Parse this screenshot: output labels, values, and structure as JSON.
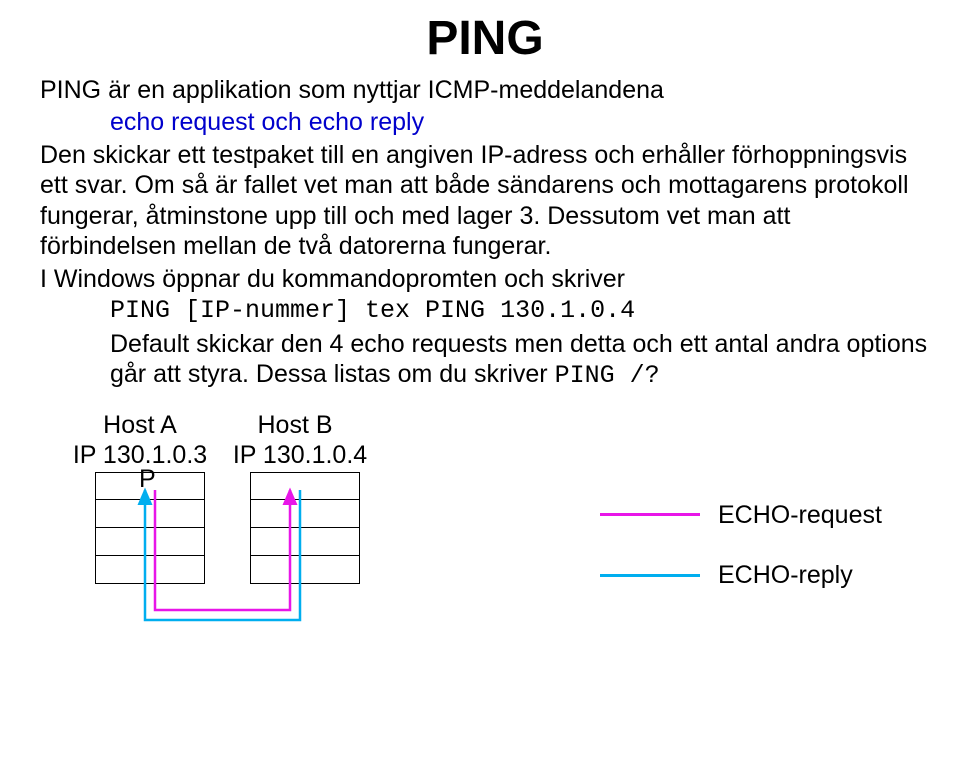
{
  "title": "PING",
  "para1_a": "PING är en applikation som nyttjar ICMP-meddelandena",
  "para1_b": "echo request och echo reply",
  "para2": "Den skickar ett testpaket till en angiven IP-adress och erhåller förhoppningsvis ett svar. Om så är fallet vet man att både sändarens och mottagarens protokoll fungerar, åtminstone upp till och med lager 3. Dessutom vet man att förbindelsen mellan de två datorerna fungerar.",
  "para3_a": "I Windows öppnar du kommandopromten och skriver",
  "para3_code": "PING [IP-nummer] tex PING 130.1.0.4",
  "para3_b": "Default skickar den 4 echo requests men detta och ett antal andra options går att styra. Dessa listas om du skriver ",
  "para3_code2": "PING /?",
  "diagram": {
    "hostA_label": "Host A",
    "hostA_ip": "IP 130.1.0.3",
    "hostB_label": "Host B",
    "hostB_ip": "IP 130.1.0.4",
    "P": "P",
    "legend_request": "ECHO-request",
    "legend_reply": "ECHO-reply"
  }
}
